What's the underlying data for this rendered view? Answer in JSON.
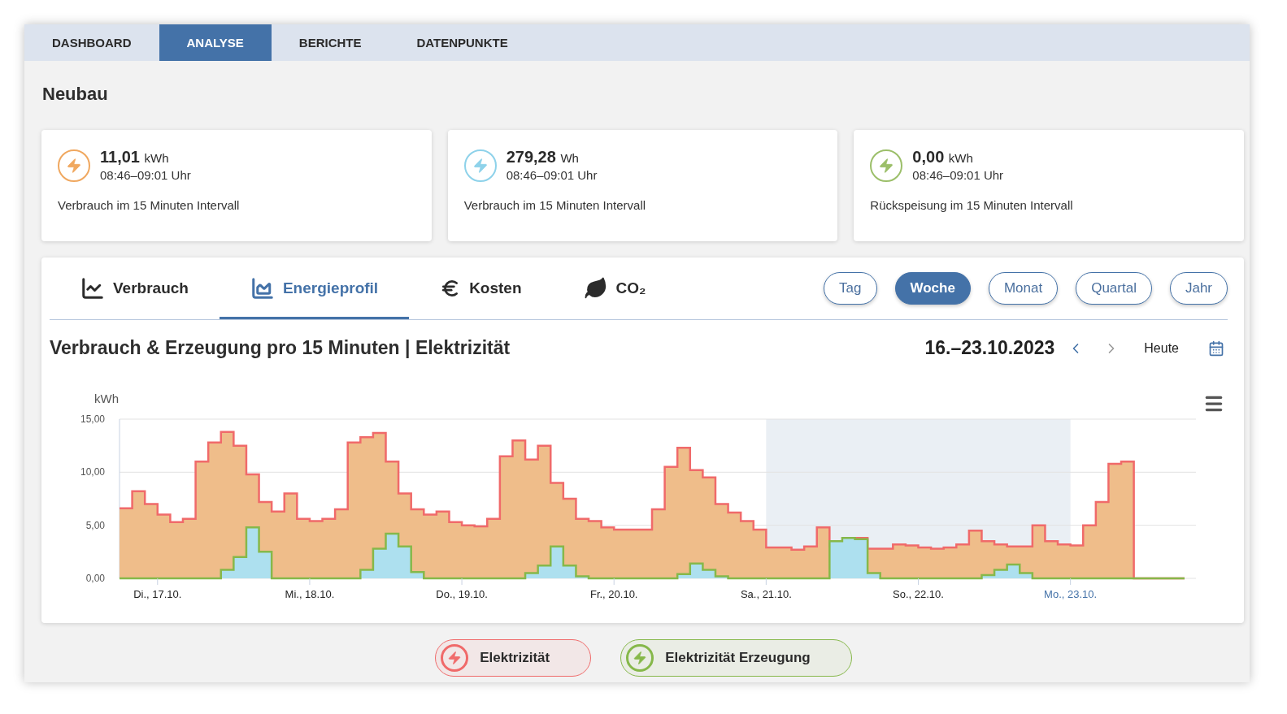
{
  "nav": [
    {
      "label": "DASHBOARD",
      "selected": false
    },
    {
      "label": "ANALYSE",
      "selected": true
    },
    {
      "label": "BERICHTE",
      "selected": false
    },
    {
      "label": "DATENPUNKTE",
      "selected": false
    }
  ],
  "title": "Neubau",
  "cards": [
    {
      "value": "11,01",
      "unit": "kWh",
      "time": "08:46–09:01 Uhr",
      "description": "Verbrauch im 15 Minuten Intervall",
      "color": "#f0a860"
    },
    {
      "value": "279,28",
      "unit": "Wh",
      "time": "08:46–09:01 Uhr",
      "description": "Verbrauch im 15 Minuten Intervall",
      "color": "#8ed2ea"
    },
    {
      "value": "0,00",
      "unit": "kWh",
      "time": "08:46–09:01 Uhr",
      "description": "Rückspeisung im 15 Minuten Intervall",
      "color": "#9cbf6a"
    }
  ],
  "view_tabs": [
    {
      "kind": "line",
      "label": "Verbrauch",
      "selected": false
    },
    {
      "kind": "area",
      "label": "Energieprofil",
      "selected": true
    },
    {
      "kind": "euro",
      "label": "Kosten",
      "selected": false
    },
    {
      "kind": "leaf",
      "label": "CO₂",
      "selected": false
    }
  ],
  "periods": [
    {
      "label": "Tag",
      "selected": false
    },
    {
      "label": "Woche",
      "selected": true
    },
    {
      "label": "Monat",
      "selected": false
    },
    {
      "label": "Quartal",
      "selected": false
    },
    {
      "label": "Jahr",
      "selected": false
    }
  ],
  "chart_title": "Verbrauch & Erzeugung pro 15 Minuten | Elektrizität",
  "date_range": "16.–23.10.2023",
  "prev": {
    "disabled": false
  },
  "next": {
    "disabled": true
  },
  "today_button": "Heute",
  "chart_data": {
    "type": "area",
    "ylabel": "kWh",
    "ylim": [
      0,
      15
    ],
    "categories": [
      null,
      null,
      null,
      "Di., 17.10.",
      null,
      null,
      null,
      null,
      null,
      null,
      null,
      null,
      null,
      null,
      null,
      "Mi., 18.10.",
      null,
      null,
      null,
      null,
      null,
      null,
      null,
      null,
      null,
      null,
      null,
      "Do., 19.10.",
      null,
      null,
      null,
      null,
      null,
      null,
      null,
      null,
      null,
      null,
      null,
      "Fr., 20.10.",
      null,
      null,
      null,
      null,
      null,
      null,
      null,
      null,
      null,
      null,
      null,
      "Sa., 21.10.",
      null,
      null,
      null,
      null,
      null,
      null,
      null,
      null,
      null,
      null,
      null,
      "So., 22.10.",
      null,
      null,
      null,
      null,
      null,
      null,
      null,
      null,
      null,
      null,
      null,
      "Mo., 23.10.",
      null,
      null,
      null,
      null,
      null,
      null,
      null,
      null
    ],
    "series": [
      {
        "name": "Elektrizität",
        "color": "#efbd8a",
        "values": [
          6.6,
          8.2,
          7.0,
          6.0,
          5.3,
          5.6,
          11.0,
          12.8,
          13.8,
          12.5,
          9.8,
          7.2,
          6.3,
          8.0,
          5.6,
          5.4,
          5.6,
          6.5,
          12.8,
          13.3,
          13.7,
          11.0,
          8.0,
          6.5,
          6.0,
          6.3,
          5.3,
          5.0,
          4.9,
          5.6,
          11.5,
          13.0,
          11.2,
          12.5,
          9.0,
          7.5,
          5.6,
          5.4,
          4.8,
          4.6,
          4.6,
          4.6,
          6.5,
          10.5,
          12.3,
          10.2,
          9.5,
          7.0,
          6.2,
          5.4,
          4.6,
          2.9,
          2.9,
          2.7,
          3.0,
          4.8,
          3.0,
          3.5,
          3.8,
          2.8,
          2.8,
          3.2,
          3.1,
          2.9,
          2.8,
          2.9,
          3.2,
          4.5,
          3.5,
          3.2,
          3.0,
          3.0,
          5.0,
          3.5,
          3.2,
          3.1,
          5.0,
          7.2,
          10.8,
          11.0,
          0,
          0,
          0,
          0
        ]
      },
      {
        "name": "Elektrizität Erzeugung",
        "color": "#ade0ef",
        "values": [
          0,
          0,
          0,
          0,
          0,
          0,
          0,
          0,
          0.8,
          2.0,
          4.8,
          2.5,
          0,
          0,
          0,
          0,
          0,
          0,
          0,
          0.8,
          2.8,
          4.2,
          3.0,
          0.6,
          0,
          0,
          0,
          0,
          0,
          0,
          0,
          0,
          0.5,
          1.2,
          3.0,
          1.2,
          0.2,
          0,
          0,
          0,
          0,
          0,
          0,
          0,
          0.4,
          1.4,
          0.8,
          0.2,
          0,
          0,
          0,
          0,
          0,
          0,
          0,
          0,
          3.5,
          3.8,
          3.7,
          0.5,
          0,
          0,
          0,
          0,
          0,
          0,
          0,
          0,
          0.3,
          0.8,
          1.3,
          0.5,
          0,
          0,
          0,
          0,
          0,
          0,
          0,
          0,
          0,
          0,
          0,
          0
        ]
      }
    ],
    "yticks": [
      {
        "value": 0,
        "label": "0,00"
      },
      {
        "value": 5,
        "label": "5,00"
      },
      {
        "value": 10,
        "label": "10,00"
      },
      {
        "value": 15,
        "label": "15,00"
      }
    ]
  },
  "legend": [
    {
      "color": "#f06a6a"
    },
    {
      "color": "#86b84a"
    }
  ]
}
